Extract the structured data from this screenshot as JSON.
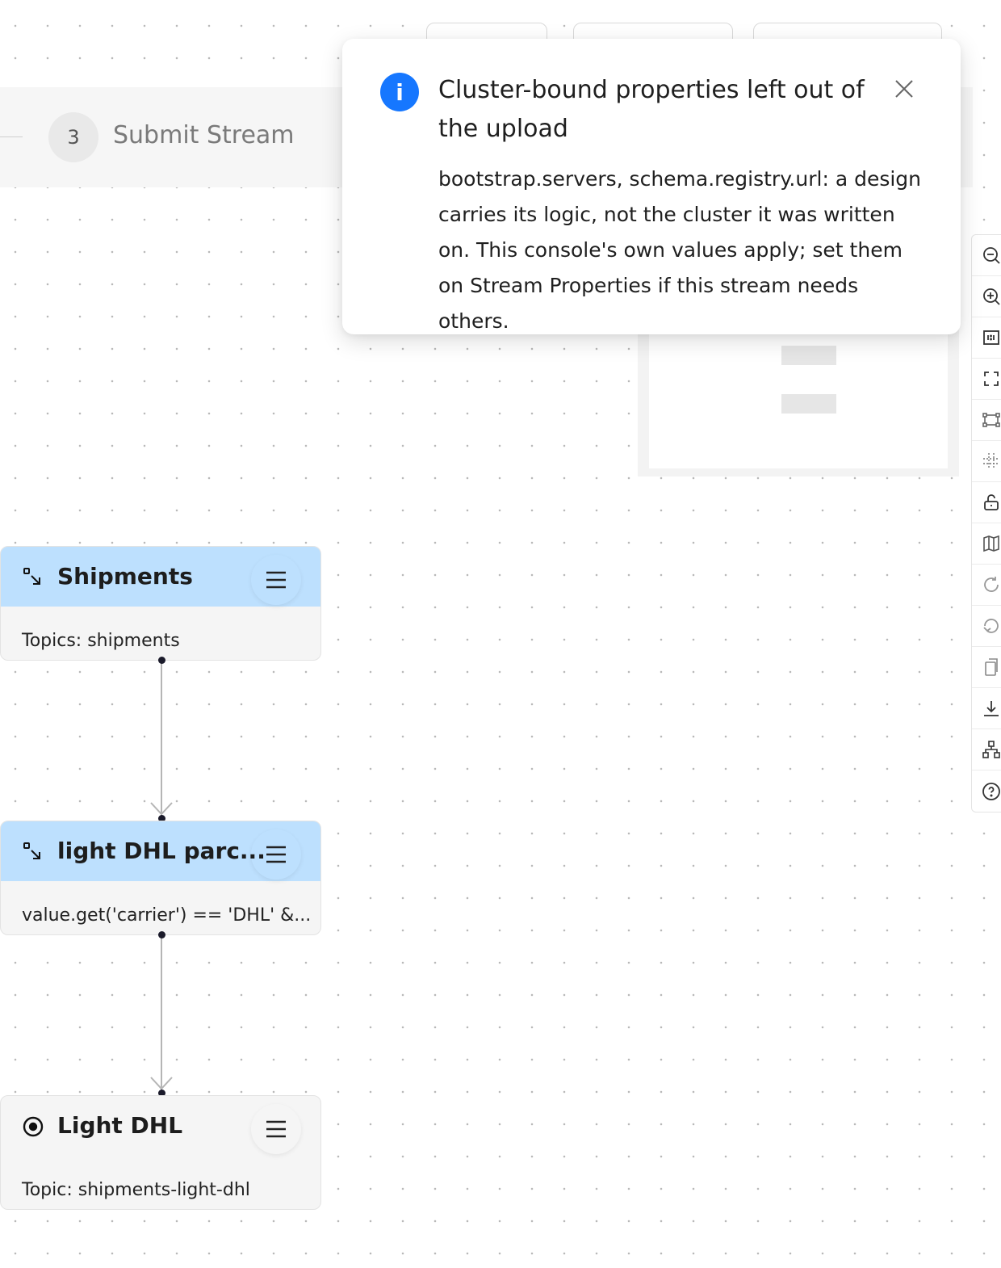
{
  "steps": {
    "current_number": "3",
    "current_label": "Submit Stream"
  },
  "toast": {
    "icon": "info-icon",
    "title": "Cluster-bound properties left out of the upload",
    "body": "bootstrap.servers, schema.registry.url: a design carries its logic, not the cluster it was written on. This console's own values apply; set them on Stream Properties if this stream needs others."
  },
  "nodes": [
    {
      "title": "Shipments",
      "body": "Topics: shipments",
      "kind": "source",
      "icon": "source-stream-icon"
    },
    {
      "title": "light DHL parc...",
      "body": "value.get('carrier') == 'DHL' &...",
      "kind": "filter",
      "icon": "filter-stream-icon"
    },
    {
      "title": "Light DHL",
      "body": "Topic: shipments-light-dhl",
      "kind": "sink",
      "icon": "sink-target-icon"
    }
  ],
  "tools": [
    "zoom-out-icon",
    "zoom-in-icon",
    "actual-size-icon",
    "fit-view-icon",
    "select-area-icon",
    "grid-snap-icon",
    "lock-icon",
    "minimap-icon",
    "undo-icon",
    "redo-icon",
    "copy-icon",
    "download-icon",
    "auto-layout-icon",
    "help-icon"
  ],
  "colors": {
    "accent": "#1677ff",
    "node_header": "#bde0fe",
    "node_body": "#f5f5f5"
  }
}
